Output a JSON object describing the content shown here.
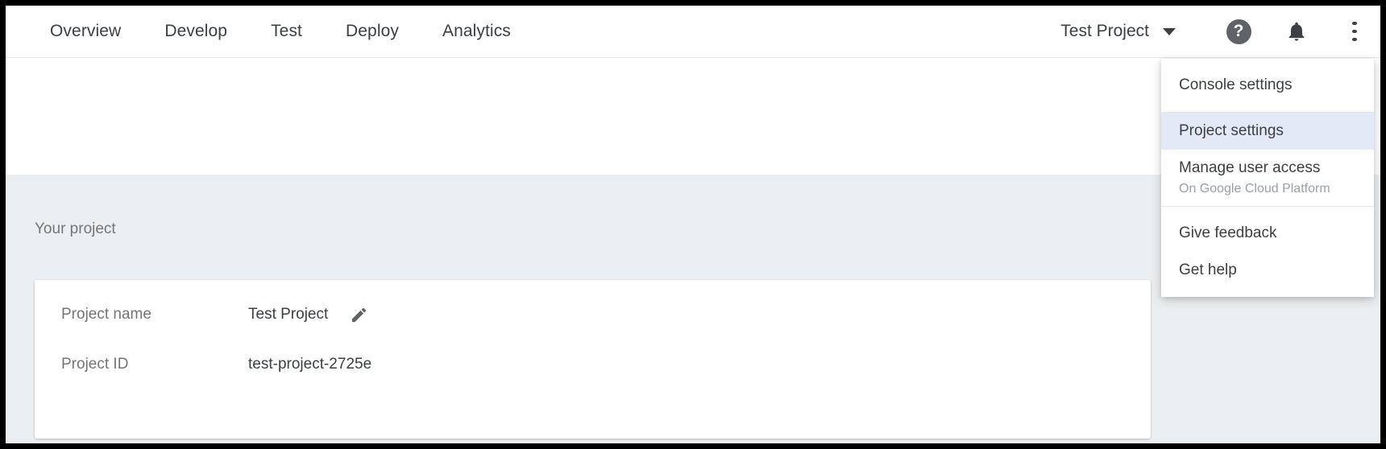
{
  "topnav": {
    "items": [
      {
        "label": "Overview"
      },
      {
        "label": "Develop"
      },
      {
        "label": "Test"
      },
      {
        "label": "Deploy"
      },
      {
        "label": "Analytics"
      }
    ],
    "project_switcher": "Test Project",
    "help_glyph": "?",
    "icons": {
      "help": "help-icon",
      "notifications": "bell-icon",
      "more": "kebab-menu-icon"
    }
  },
  "page": {
    "section_label": "Your project",
    "card": {
      "rows": [
        {
          "label": "Project name",
          "value": "Test Project",
          "has_edit": true
        },
        {
          "label": "Project ID",
          "value": "test-project-2725e",
          "has_edit": false
        }
      ]
    }
  },
  "kebab_menu": {
    "groups": [
      {
        "items": [
          {
            "label": "Console settings",
            "sub": "",
            "selected": false
          }
        ]
      },
      {
        "items": [
          {
            "label": "Project settings",
            "sub": "",
            "selected": true
          },
          {
            "label": "Manage user access",
            "sub": "On Google Cloud Platform",
            "selected": false
          }
        ]
      },
      {
        "items": [
          {
            "label": "Give feedback",
            "sub": "",
            "selected": false
          },
          {
            "label": "Get help",
            "sub": "",
            "selected": false
          }
        ]
      }
    ]
  },
  "colors": {
    "text_primary": "#3c4043",
    "text_secondary": "#757575",
    "text_muted": "#9aa0a6",
    "page_bg": "#eceff1",
    "card_bg": "#ffffff",
    "menu_selected_bg": "#e4e9f7",
    "icon_fill": "#5f6368"
  }
}
